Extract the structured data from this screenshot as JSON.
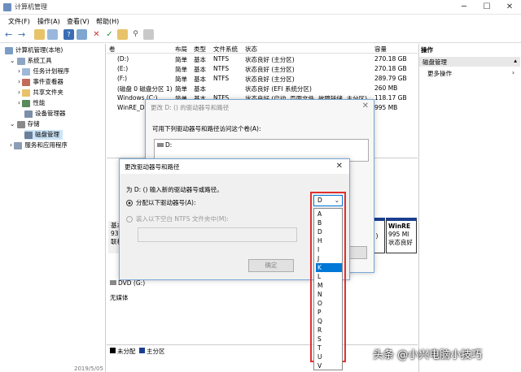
{
  "window": {
    "title": "计算机管理"
  },
  "menu": [
    "文件(F)",
    "操作(A)",
    "查看(V)",
    "帮助(H)"
  ],
  "tree": [
    {
      "label": "计算机管理(本地)",
      "indent": 0
    },
    {
      "label": "系统工具",
      "indent": 1
    },
    {
      "label": "任务计划程序",
      "indent": 2
    },
    {
      "label": "事件查看器",
      "indent": 2
    },
    {
      "label": "共享文件夹",
      "indent": 2
    },
    {
      "label": "性能",
      "indent": 2
    },
    {
      "label": "设备管理器",
      "indent": 2
    },
    {
      "label": "存储",
      "indent": 1
    },
    {
      "label": "磁盘管理",
      "indent": 2
    },
    {
      "label": "服务和应用程序",
      "indent": 1
    }
  ],
  "table": {
    "headers": [
      "卷",
      "布局",
      "类型",
      "文件系统",
      "状态",
      "容量"
    ],
    "rows": [
      [
        "(D:)",
        "简单",
        "基本",
        "NTFS",
        "状态良好 (主分区)",
        "270.18 GB"
      ],
      [
        "(E:)",
        "简单",
        "基本",
        "NTFS",
        "状态良好 (主分区)",
        "270.18 GB"
      ],
      [
        "(F:)",
        "简单",
        "基本",
        "NTFS",
        "状态良好 (主分区)",
        "289.79 GB"
      ],
      [
        "(磁盘 0 磁盘分区 1)",
        "简单",
        "基本",
        "",
        "状态良好 (EFI 系统分区)",
        "260 MB"
      ],
      [
        "Windows (C:)",
        "简单",
        "基本",
        "NTFS",
        "状态良好 (启动, 页面文件, 故障转储, 主分区)",
        "118.17 GB"
      ],
      [
        "WinRE_DR",
        "",
        "",
        "",
        "",
        "995 MB"
      ]
    ]
  },
  "actions": {
    "header": "操作",
    "section": "磁盘管理",
    "more": "更多操作"
  },
  "bottom": {
    "disk_label": "基本",
    "disk_size": "93",
    "disk_status": "联机",
    "dvd": "DVD (G:)",
    "nomedia": "无媒体",
    "winre_name": "WinRE",
    "winre_size": "995 MI",
    "winre_status": "状态良好",
    "date": "2019/5/05",
    "legend_unalloc": "未分配",
    "legend_primary": "主分区"
  },
  "dialog_back": {
    "title": "更改 D: () 的驱动器号和路径",
    "prompt": "可用下列驱动器号和路径访问这个卷(A):",
    "list_item": "D:"
  },
  "dialog_front": {
    "title": "更改驱动器号和路径",
    "prompt": "为 D: () 输入新的驱动器号或路径。",
    "radio1": "分配以下驱动器号(A):",
    "radio2": "装入以下空白 NTFS 文件夹中(M):",
    "ok": "确定",
    "selected": "D"
  },
  "dropdown": [
    "A",
    "B",
    "D",
    "H",
    "I",
    "J",
    "K",
    "L",
    "M",
    "N",
    "O",
    "P",
    "Q",
    "R",
    "S",
    "T",
    "U",
    "V"
  ],
  "dropdown_highlight": "K",
  "watermark": "头条 @小兴电脑小技巧",
  "colors": {
    "accent": "#0078d7",
    "highlight_border": "#e03030",
    "action_header": "#e8e8e8"
  }
}
